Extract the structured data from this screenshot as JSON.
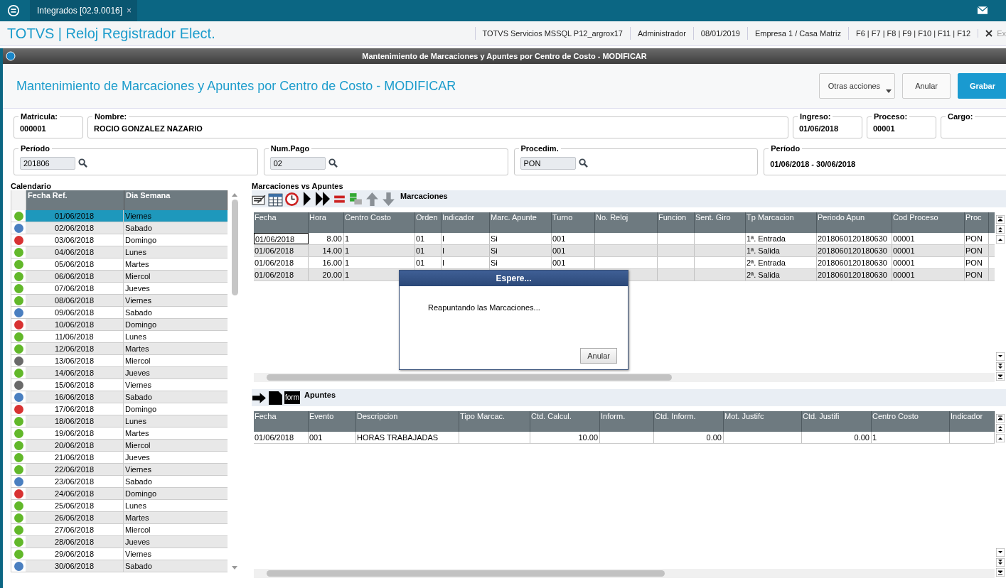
{
  "top_tab": {
    "label": "Integrados [02.9.0016]",
    "close": "×"
  },
  "app": {
    "title": "TOTVS | Reloj Registrador Elect.",
    "info": [
      "TOTVS Servicios MSSQL P12_argrox17",
      "Administrador",
      "08/01/2019",
      "Empresa 1 / Casa Matriz",
      "F6 | F7 | F8 | F9 | F10 | F11 | F12"
    ],
    "exit": "Ex"
  },
  "window": {
    "title": "Mantenimiento de Marcaciones y Apuntes por Centro de Costo - MODIFICAR"
  },
  "header": {
    "title": "Mantenimiento de Marcaciones y Apuntes por Centro de Costo - MODIFICAR",
    "buttons": [
      {
        "label": "Otras acciones",
        "kind": "menu"
      },
      {
        "label": "Anular",
        "kind": "plain"
      },
      {
        "label": "Grabar",
        "kind": "primary"
      }
    ]
  },
  "fields_row1": [
    {
      "label": "Matricula:",
      "value": "000001"
    },
    {
      "label": "Nombre:",
      "value": "ROCIO  GONZALEZ NAZARIO"
    },
    {
      "label": "Ingreso:",
      "value": "01/06/2018"
    },
    {
      "label": "Proceso:",
      "value": "00001"
    },
    {
      "label": "Cargo:"
    }
  ],
  "fields_row2": [
    {
      "label": "Período",
      "value": "201806",
      "kind": "lookup"
    },
    {
      "label": "Num.Pago",
      "value": "02",
      "kind": "lookup"
    },
    {
      "label": "Procedim.",
      "value": "PON",
      "kind": "lookup"
    },
    {
      "label": "Período",
      "value": "01/06/2018 - 30/06/2018",
      "kind": "text"
    }
  ],
  "calendar": {
    "label": "Calendario",
    "columns": [
      "Fecha Ref.",
      "Dia Semana"
    ],
    "rows": [
      {
        "date": "01/06/2018",
        "day": "Viernes",
        "color": "#62b82a",
        "selected": true
      },
      {
        "date": "02/06/2018",
        "day": "Sabado",
        "color": "#4a7fc0",
        "selected": false
      },
      {
        "date": "03/06/2018",
        "day": "Domingo",
        "color": "#d83232",
        "selected": false
      },
      {
        "date": "04/06/2018",
        "day": "Lunes",
        "color": "#62b82a",
        "selected": false
      },
      {
        "date": "05/06/2018",
        "day": "Martes",
        "color": "#62b82a",
        "selected": false
      },
      {
        "date": "06/06/2018",
        "day": "Miercol",
        "color": "#62b82a",
        "selected": false
      },
      {
        "date": "07/06/2018",
        "day": "Jueves",
        "color": "#62b82a",
        "selected": false
      },
      {
        "date": "08/06/2018",
        "day": "Viernes",
        "color": "#62b82a",
        "selected": false
      },
      {
        "date": "09/06/2018",
        "day": "Sabado",
        "color": "#4a7fc0",
        "selected": false
      },
      {
        "date": "10/06/2018",
        "day": "Domingo",
        "color": "#d83232",
        "selected": false
      },
      {
        "date": "11/06/2018",
        "day": "Lunes",
        "color": "#62b82a",
        "selected": false
      },
      {
        "date": "12/06/2018",
        "day": "Martes",
        "color": "#62b82a",
        "selected": false
      },
      {
        "date": "13/06/2018",
        "day": "Miercol",
        "color": "#6a6a6a",
        "selected": false
      },
      {
        "date": "14/06/2018",
        "day": "Jueves",
        "color": "#62b82a",
        "selected": false
      },
      {
        "date": "15/06/2018",
        "day": "Viernes",
        "color": "#6a6a6a",
        "selected": false
      },
      {
        "date": "16/06/2018",
        "day": "Sabado",
        "color": "#4a7fc0",
        "selected": false
      },
      {
        "date": "17/06/2018",
        "day": "Domingo",
        "color": "#d83232",
        "selected": false
      },
      {
        "date": "18/06/2018",
        "day": "Lunes",
        "color": "#62b82a",
        "selected": false
      },
      {
        "date": "19/06/2018",
        "day": "Martes",
        "color": "#62b82a",
        "selected": false
      },
      {
        "date": "20/06/2018",
        "day": "Miercol",
        "color": "#62b82a",
        "selected": false
      },
      {
        "date": "21/06/2018",
        "day": "Jueves",
        "color": "#62b82a",
        "selected": false
      },
      {
        "date": "22/06/2018",
        "day": "Viernes",
        "color": "#62b82a",
        "selected": false
      },
      {
        "date": "23/06/2018",
        "day": "Sabado",
        "color": "#4a7fc0",
        "selected": false
      },
      {
        "date": "24/06/2018",
        "day": "Domingo",
        "color": "#d83232",
        "selected": false
      },
      {
        "date": "25/06/2018",
        "day": "Lunes",
        "color": "#62b82a",
        "selected": false
      },
      {
        "date": "26/06/2018",
        "day": "Martes",
        "color": "#62b82a",
        "selected": false
      },
      {
        "date": "27/06/2018",
        "day": "Miercol",
        "color": "#62b82a",
        "selected": false
      },
      {
        "date": "28/06/2018",
        "day": "Jueves",
        "color": "#62b82a",
        "selected": false
      },
      {
        "date": "29/06/2018",
        "day": "Viernes",
        "color": "#62b82a",
        "selected": false
      },
      {
        "date": "30/06/2018",
        "day": "Sabado",
        "color": "#4a7fc0",
        "selected": false
      }
    ]
  },
  "section_label": "Marcaciones vs Apuntes",
  "marcaciones": {
    "label": "Marcaciones",
    "columns": [
      "Fecha",
      "Hora",
      "Centro Costo",
      "Orden",
      "Indicador",
      "Marc. Apunte",
      "Turno",
      "No. Reloj",
      "Funcion",
      "Sent. Giro",
      "Tp Marcacion",
      "Periodo Apun",
      "Cod Proceso",
      "Proc"
    ],
    "rows": [
      [
        "01/06/2018",
        "8.00",
        "1",
        "01",
        "I",
        "Si",
        "001",
        null,
        null,
        null,
        "1ª. Entrada",
        "2018060120180630",
        "00001",
        "PON"
      ],
      [
        "01/06/2018",
        "14.00",
        "1",
        "01",
        "I",
        "Si",
        "001",
        null,
        null,
        null,
        "1ª. Salida",
        "2018060120180630",
        "00001",
        "PON"
      ],
      [
        "01/06/2018",
        "16.00",
        "1",
        "01",
        "I",
        "Si",
        "001",
        null,
        null,
        null,
        "2ª. Entrada",
        "2018060120180630",
        "00001",
        "PON"
      ],
      [
        "01/06/2018",
        "20.00",
        "1",
        null,
        null,
        null,
        null,
        null,
        null,
        null,
        "2ª. Salida",
        "2018060120180630",
        "00001",
        "PON"
      ]
    ]
  },
  "apuntes": {
    "label": "Apuntes",
    "tool_tag": "form",
    "columns": [
      "Fecha",
      "Evento",
      "Descripcion",
      "Tipo Marcac.",
      "Ctd. Calcul.",
      "Inform.",
      "Ctd. Inform.",
      "Mot. Justifc",
      "Ctd. Justifi",
      "Centro Costo",
      "Indicador"
    ],
    "rows": [
      [
        "01/06/2018",
        "001",
        "HORAS TRABAJADAS",
        null,
        "10.00",
        null,
        "0.00",
        null,
        "0.00",
        "1",
        null
      ]
    ]
  },
  "dialog": {
    "title": "Espere...",
    "message": "Reapuntando las Marcaciones...",
    "button": "Anular"
  }
}
